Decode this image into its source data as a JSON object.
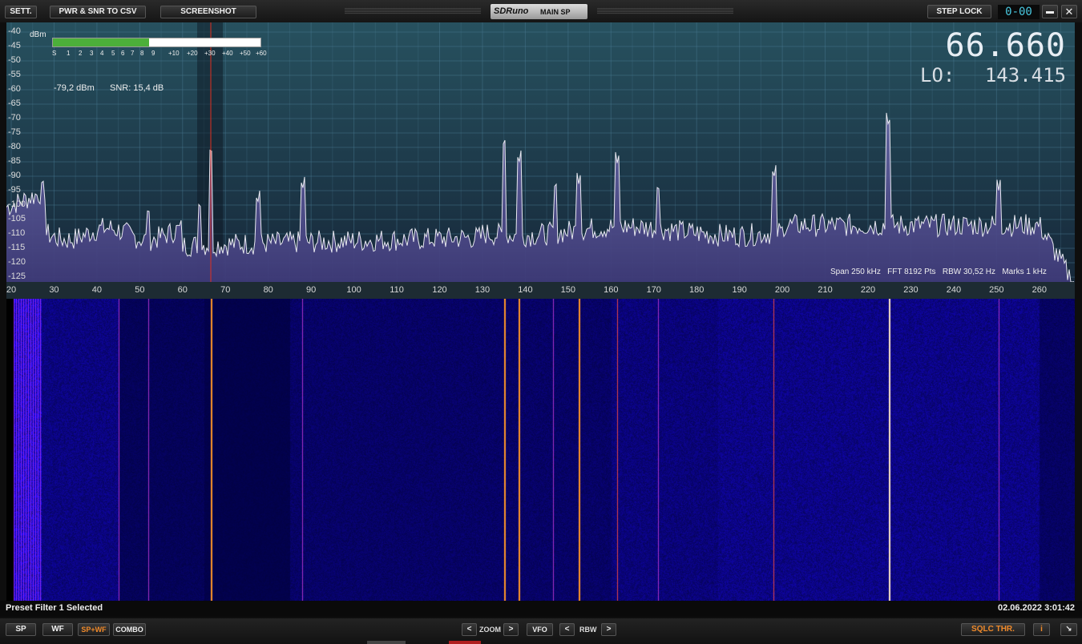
{
  "toolbar": {
    "sett": "SETT.",
    "pwr_snr": "PWR & SNR TO CSV",
    "screenshot": "SCREENSHOT",
    "brand": "SDRuno",
    "main_sp": "MAIN SP",
    "step_lock": "STEP LOCK",
    "clock": "0-00",
    "minimize": "▬",
    "close": "✕"
  },
  "display": {
    "frequency": "66.660",
    "lo_label": "LO:",
    "lo_value": "143.415",
    "dbm_unit": "dBm",
    "level": "-79,2 dBm",
    "snr": "SNR: 15,4 dB",
    "info": "Span 250 kHz   FFT 8192 Pts   RBW 30,52 Hz   Marks 1 kHz",
    "smeter_labels": [
      "S",
      "1",
      "2",
      "3",
      "4",
      "5",
      "6",
      "7",
      "8",
      "9",
      "+10",
      "+20",
      "+30",
      "+40",
      "+50",
      "+60"
    ],
    "smeter_fill": 0.465,
    "db_scale": [
      "-40",
      "-45",
      "-50",
      "-55",
      "-60",
      "-65",
      "-70",
      "-75",
      "-80",
      "-85",
      "-90",
      "-95",
      "-100",
      "-105",
      "-110",
      "-115",
      "-120",
      "-125"
    ],
    "freq_axis": [
      "20",
      "30",
      "40",
      "50",
      "60",
      "70",
      "80",
      "90",
      "100",
      "110",
      "120",
      "130",
      "140",
      "150",
      "160",
      "170",
      "180",
      "190",
      "200",
      "210",
      "220",
      "230",
      "240",
      "250",
      "260"
    ]
  },
  "status": {
    "left": "Preset Filter 1 Selected",
    "right": "02.06.2022 3:01:42"
  },
  "bottom": {
    "sp": "SP",
    "wf": "WF",
    "spwf": "SP+WF",
    "combo": "COMBO",
    "zoom_prev": "<",
    "zoom": "ZOOM",
    "zoom_next": ">",
    "vfo": "VFO",
    "rbw_prev": "<",
    "rbw": "RBW",
    "rbw_next": ">",
    "sqlc": "SQLC THR.",
    "info": "i",
    "resize": "↘"
  },
  "colors": {
    "accent": "#f08a2a",
    "spectrum_trace": "#e8e8f0",
    "marker": "#e03020",
    "smeter": "#4caf3a"
  }
}
